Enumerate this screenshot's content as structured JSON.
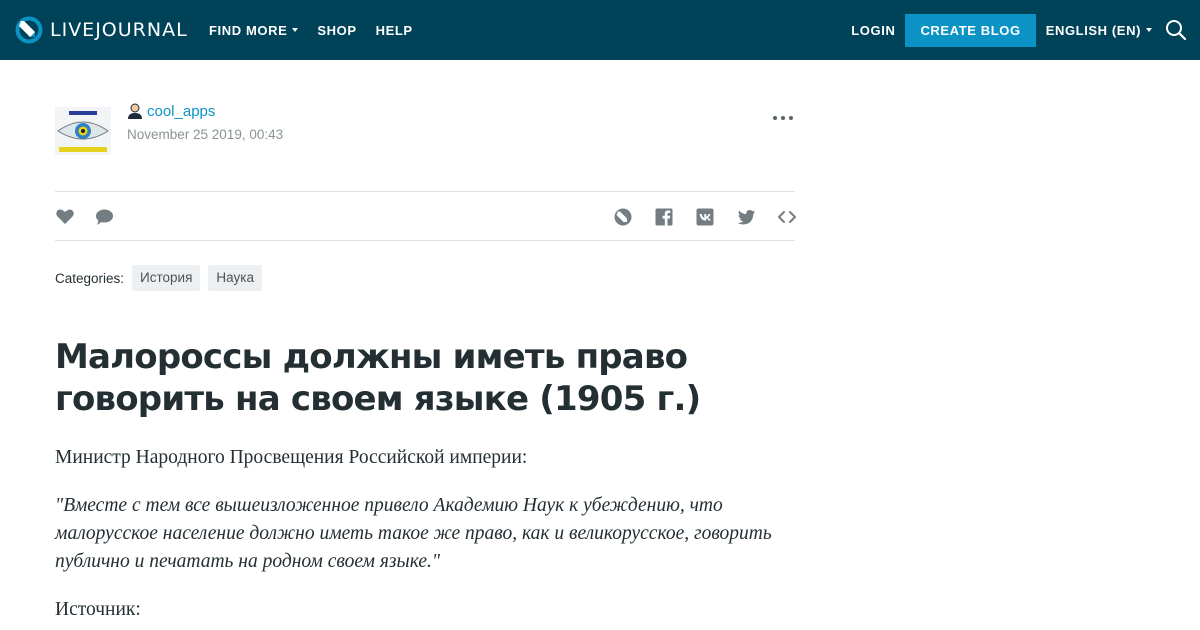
{
  "header": {
    "logo_text": "LIVEJOURNAL",
    "nav_left": [
      {
        "label": "FIND MORE",
        "has_caret": true
      },
      {
        "label": "SHOP",
        "has_caret": false
      },
      {
        "label": "HELP",
        "has_caret": false
      }
    ],
    "login_label": "LOGIN",
    "create_blog_label": "CREATE BLOG",
    "language_label": "ENGLISH (EN)"
  },
  "post": {
    "author": "cool_apps",
    "date": "November 25 2019, 00:43",
    "categories_label": "Categories:",
    "categories": [
      "История",
      "Наука"
    ],
    "title": "Малороссы должны иметь право говорить на своем языке (1905 г.)",
    "paragraph_1": "Министр Народного Просвещения Российской империи:",
    "quote": "\"Вместе с тем все вышеизложенное привело Академию Наук к убеждению, что малорусское население должно иметь такое же право, как и великорусское, говорить публично и печатать на родном своем языке.\"",
    "paragraph_3": "Источник:"
  },
  "icons": {
    "logo": "livejournal-pencil-icon",
    "search": "search-icon",
    "user": "user-icon",
    "more": "more-dots-icon",
    "like": "heart-icon",
    "comment": "comment-icon",
    "share": [
      "livejournal-share-icon",
      "facebook-icon",
      "vk-icon",
      "twitter-icon",
      "embed-code-icon"
    ]
  },
  "colors": {
    "header_bg": "#004359",
    "accent": "#0b93c6",
    "text": "#242f33",
    "muted": "#8a9396"
  }
}
